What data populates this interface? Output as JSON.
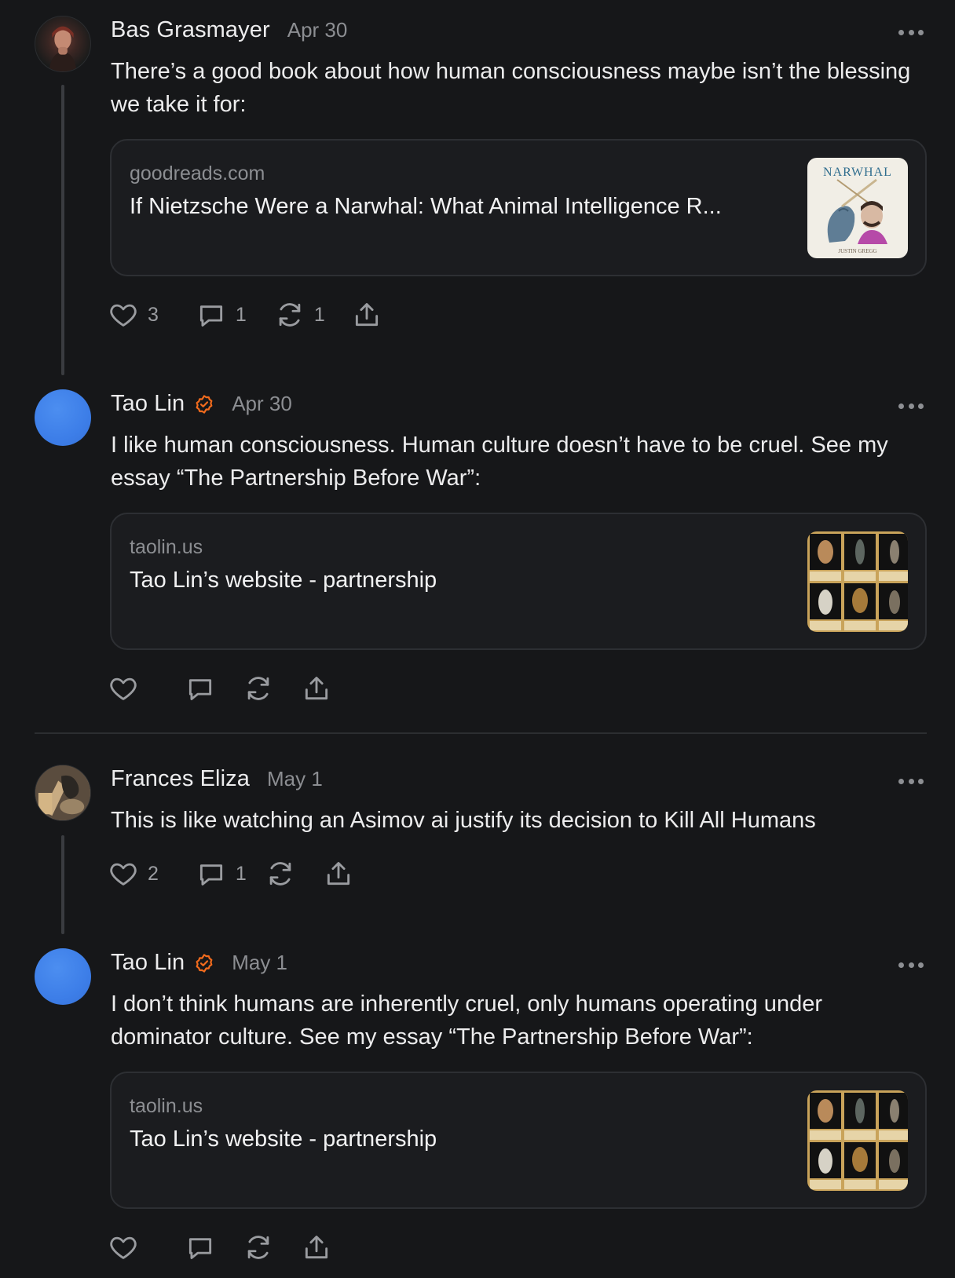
{
  "posts": [
    {
      "author": "Bas Grasmayer",
      "date": "Apr 30",
      "verified": false,
      "text": "There’s a good book about how human consciousness maybe isn’t the blessing we take it for:",
      "card": {
        "domain": "goodreads.com",
        "title": "If Nietzsche Were a Narwhal: What Animal Intelligence R...",
        "thumb_title": "NARWHAL",
        "thumb_author": "JUSTIN GREGG"
      },
      "likes": "3",
      "comments": "1",
      "restacks": "1"
    },
    {
      "author": "Tao Lin",
      "date": "Apr 30",
      "verified": true,
      "text": "I like human consciousness. Human culture doesn’t have to be cruel. See my essay “The Partnership Before War”:",
      "card": {
        "domain": "taolin.us",
        "title": "Tao Lin’s website - partnership"
      },
      "likes": "",
      "comments": "",
      "restacks": ""
    },
    {
      "author": "Frances Eliza",
      "date": "May 1",
      "verified": false,
      "text": "This is like watching an Asimov ai justify its decision to Kill All Humans",
      "likes": "2",
      "comments": "1",
      "restacks": ""
    },
    {
      "author": "Tao Lin",
      "date": "May 1",
      "verified": true,
      "text": "I don’t think humans are inherently cruel, only humans operating under dominator culture. See my essay “The Partnership Before War”:",
      "card": {
        "domain": "taolin.us",
        "title": "Tao Lin’s website - partnership"
      },
      "likes": "",
      "comments": "",
      "restacks": ""
    }
  ],
  "icons": {
    "like": "heart-icon",
    "comment": "comment-icon",
    "restack": "restack-icon",
    "share": "share-icon",
    "verified": "verified-check-icon",
    "more": "more-options-icon"
  },
  "colors": {
    "background": "#161719",
    "text": "#ececed",
    "muted": "#8c8e92",
    "verified": "#f26b1d",
    "avatar_blue": "#3d7ee8"
  }
}
